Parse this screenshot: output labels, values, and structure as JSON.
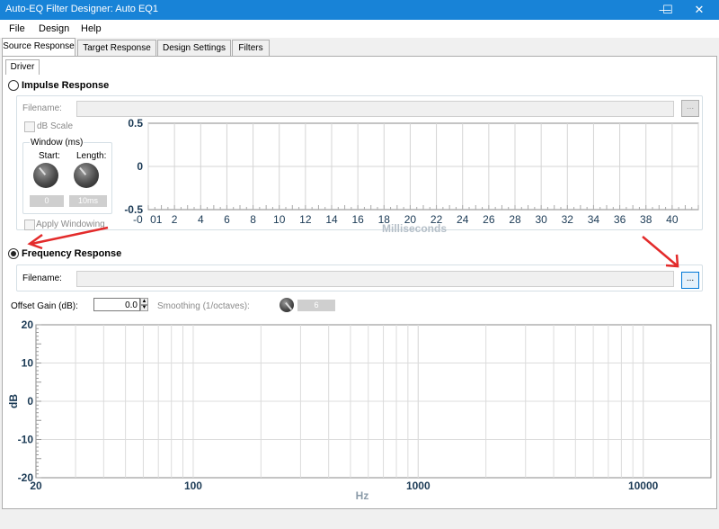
{
  "window": {
    "title": "Auto-EQ Filter Designer: Auto EQ1",
    "minimize": "—",
    "maximize": "☐",
    "close": "✕"
  },
  "menu": [
    "File",
    "Design",
    "Help"
  ],
  "tabs": [
    "Source Response",
    "Target Response",
    "Design Settings",
    "Filters"
  ],
  "subtab": "Driver",
  "impulse": {
    "heading": "Impulse Response",
    "filename_label": "Filename:",
    "db_scale": "dB Scale",
    "window_group": "Window (ms)",
    "start_label": "Start:",
    "length_label": "Length:",
    "start_value": "0",
    "length_value": "10ms",
    "apply_windowing": "Apply Windowing",
    "browse": "..."
  },
  "frequency": {
    "heading": "Frequency Response",
    "filename_label": "Filename:",
    "browse": "..."
  },
  "offset_gain_label": "Offset Gain (dB):",
  "offset_gain_value": "0.0",
  "smoothing_label": "Smoothing (1/octaves):",
  "smoothing_value": "6",
  "chart_data": [
    {
      "type": "line",
      "xlabel": "Milliseconds",
      "ylabel": "",
      "x_ticks": [
        "-0",
        "01",
        "2",
        "4",
        "6",
        "8",
        "10",
        "12",
        "14",
        "16",
        "18",
        "20",
        "22",
        "24",
        "26",
        "28",
        "30",
        "32",
        "34",
        "36",
        "38",
        "40"
      ],
      "y_ticks": [
        "0.5",
        "0",
        "-0.5"
      ],
      "xlim": [
        0,
        42
      ],
      "ylim": [
        -0.5,
        0.5
      ],
      "grid": true,
      "series": []
    },
    {
      "type": "line",
      "xlabel": "Hz",
      "ylabel": "dB",
      "x_scale": "log",
      "x_ticks": [
        "20",
        "100",
        "1000",
        "10000"
      ],
      "y_ticks": [
        "20",
        "10",
        "0",
        "-10",
        "-20"
      ],
      "xlim": [
        20,
        20000
      ],
      "ylim": [
        -20,
        20
      ],
      "grid": true,
      "series": []
    }
  ]
}
